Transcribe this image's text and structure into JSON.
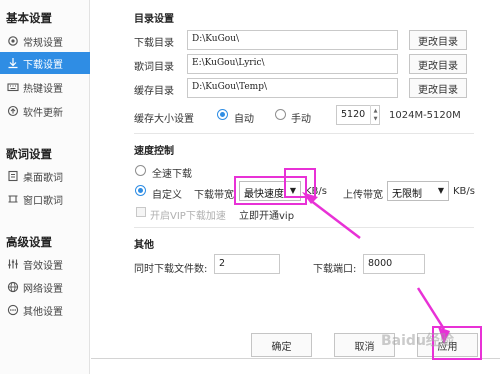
{
  "sidebar": {
    "sections": [
      {
        "title": "基本设置",
        "items": [
          {
            "label": "常规设置",
            "icon": "gear-icon"
          },
          {
            "label": "下载设置",
            "icon": "download-icon",
            "active": true
          },
          {
            "label": "热键设置",
            "icon": "keyboard-icon"
          },
          {
            "label": "软件更新",
            "icon": "update-icon"
          }
        ]
      },
      {
        "title": "歌词设置",
        "items": [
          {
            "label": "桌面歌词",
            "icon": "desktop-lyric-icon"
          },
          {
            "label": "窗口歌词",
            "icon": "window-lyric-icon"
          }
        ]
      },
      {
        "title": "高级设置",
        "items": [
          {
            "label": "音效设置",
            "icon": "equalizer-icon"
          },
          {
            "label": "网络设置",
            "icon": "network-icon"
          },
          {
            "label": "其他设置",
            "icon": "more-icon"
          }
        ]
      }
    ]
  },
  "directory": {
    "title": "目录设置",
    "rows": [
      {
        "label": "下载目录",
        "value": "D:\\KuGou\\",
        "button": "更改目录"
      },
      {
        "label": "歌词目录",
        "value": "E:\\KuGou\\Lyric\\",
        "button": "更改目录"
      },
      {
        "label": "缓存目录",
        "value": "D:\\KuGou\\Temp\\",
        "button": "更改目录"
      }
    ],
    "cache_size_label": "缓存大小设置",
    "auto_label": "自动",
    "manual_label": "手动",
    "cache_value": "5120",
    "cache_range": "1024M-5120M"
  },
  "speed": {
    "title": "速度控制",
    "full_speed_label": "全速下载",
    "custom_label": "自定义",
    "download_bw_label": "下载带宽",
    "download_bw_value": "最快速度",
    "download_unit": "KB/s",
    "upload_bw_label": "上传带宽",
    "upload_bw_value": "无限制",
    "upload_unit": "KB/s",
    "vip_label": "开启VIP下载加速",
    "vip_link": "立即开通vip"
  },
  "other": {
    "title": "其他",
    "concurrent_label": "同时下载文件数:",
    "concurrent_value": "2",
    "port_label": "下载端口:",
    "port_value": "8000"
  },
  "footer": {
    "ok": "确定",
    "cancel": "取消",
    "apply": "应用"
  },
  "watermark": "Baidu经验",
  "colors": {
    "accent": "#2f8de4",
    "highlight": "#e831d6"
  }
}
